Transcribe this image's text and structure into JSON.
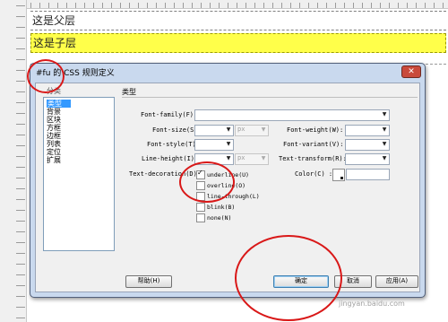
{
  "editor": {
    "parent_text": "这是父层",
    "child_text": "这是子层"
  },
  "dialog": {
    "title": "#fu 的 CSS 规则定义",
    "close_label": "✕",
    "category_label": "分类",
    "categories": [
      {
        "label": "类型",
        "selected": true
      },
      {
        "label": "背景",
        "selected": false
      },
      {
        "label": "区块",
        "selected": false
      },
      {
        "label": "方框",
        "selected": false
      },
      {
        "label": "边框",
        "selected": false
      },
      {
        "label": "列表",
        "selected": false
      },
      {
        "label": "定位",
        "selected": false
      },
      {
        "label": "扩展",
        "selected": false
      }
    ],
    "section_title": "类型",
    "fields": {
      "font_family": {
        "label": "Font-family(F):",
        "value": ""
      },
      "font_size": {
        "label": "Font-size(S):",
        "value": "",
        "unit": "px"
      },
      "font_weight": {
        "label": "Font-weight(W):",
        "value": ""
      },
      "font_style": {
        "label": "Font-style(T):",
        "value": ""
      },
      "font_variant": {
        "label": "Font-variant(V):",
        "value": ""
      },
      "line_height": {
        "label": "Line-height(I):",
        "value": "",
        "unit": "px"
      },
      "text_transform": {
        "label": "Text-transform(R):",
        "value": ""
      },
      "text_decoration": {
        "label": "Text-decoration(D):"
      },
      "color": {
        "label": "Color(C) :",
        "value": ""
      }
    },
    "decorations": [
      {
        "label": "underline(U)",
        "checked": true
      },
      {
        "label": "overline(O)",
        "checked": false
      },
      {
        "label": "line-through(L)",
        "checked": false
      },
      {
        "label": "blink(B)",
        "checked": false
      },
      {
        "label": "none(N)",
        "checked": false
      }
    ],
    "buttons": {
      "help": "帮助(H)",
      "ok": "确定",
      "cancel": "取消",
      "apply": "应用(A)"
    }
  },
  "watermark": "jingyan.baidu.com",
  "accent_colors": {
    "highlight": "#ffff4a",
    "selection": "#3399ff",
    "annotation": "#d91818"
  }
}
